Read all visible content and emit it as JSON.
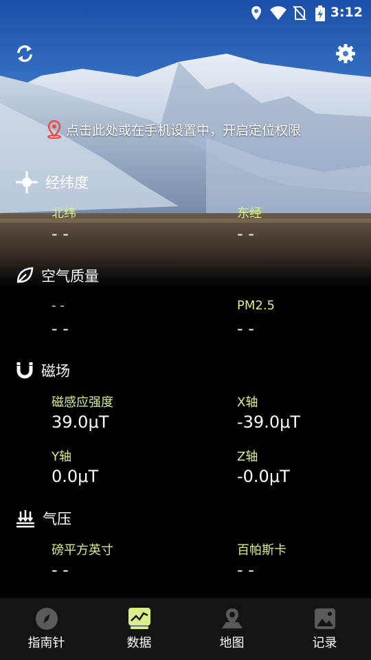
{
  "status": {
    "time": "3:12"
  },
  "location_prompt": "点击此处或在手机设置中，开启定位权限",
  "sections": {
    "coords": {
      "title": "经纬度",
      "items": [
        {
          "label": "北纬",
          "value": "- -"
        },
        {
          "label": "东经",
          "value": "- -"
        }
      ]
    },
    "air": {
      "title": "空气质量",
      "items": [
        {
          "label": "- -",
          "value": "- -"
        },
        {
          "label": "PM2.5",
          "value": "- -"
        }
      ]
    },
    "magnetic": {
      "title": "磁场",
      "items": [
        {
          "label": "磁感应强度",
          "value": "39.0μT"
        },
        {
          "label": "X轴",
          "value": "-39.0μT"
        },
        {
          "label": "Y轴",
          "value": "0.0μT"
        },
        {
          "label": "Z轴",
          "value": "-0.0μT"
        }
      ]
    },
    "pressure": {
      "title": "气压",
      "items": [
        {
          "label": "磅平方英寸",
          "value": "- -"
        },
        {
          "label": "百帕斯卡",
          "value": "- -"
        }
      ]
    }
  },
  "nav": [
    {
      "label": "指南针",
      "icon": "compass-icon"
    },
    {
      "label": "数据",
      "icon": "data-chart-icon",
      "active": true
    },
    {
      "label": "地图",
      "icon": "map-pin-icon"
    },
    {
      "label": "记录",
      "icon": "gallery-icon"
    }
  ],
  "colors": {
    "label": "#d7ee8a",
    "active_nav": "#d7ee8a",
    "nav_bg": "#141414"
  }
}
